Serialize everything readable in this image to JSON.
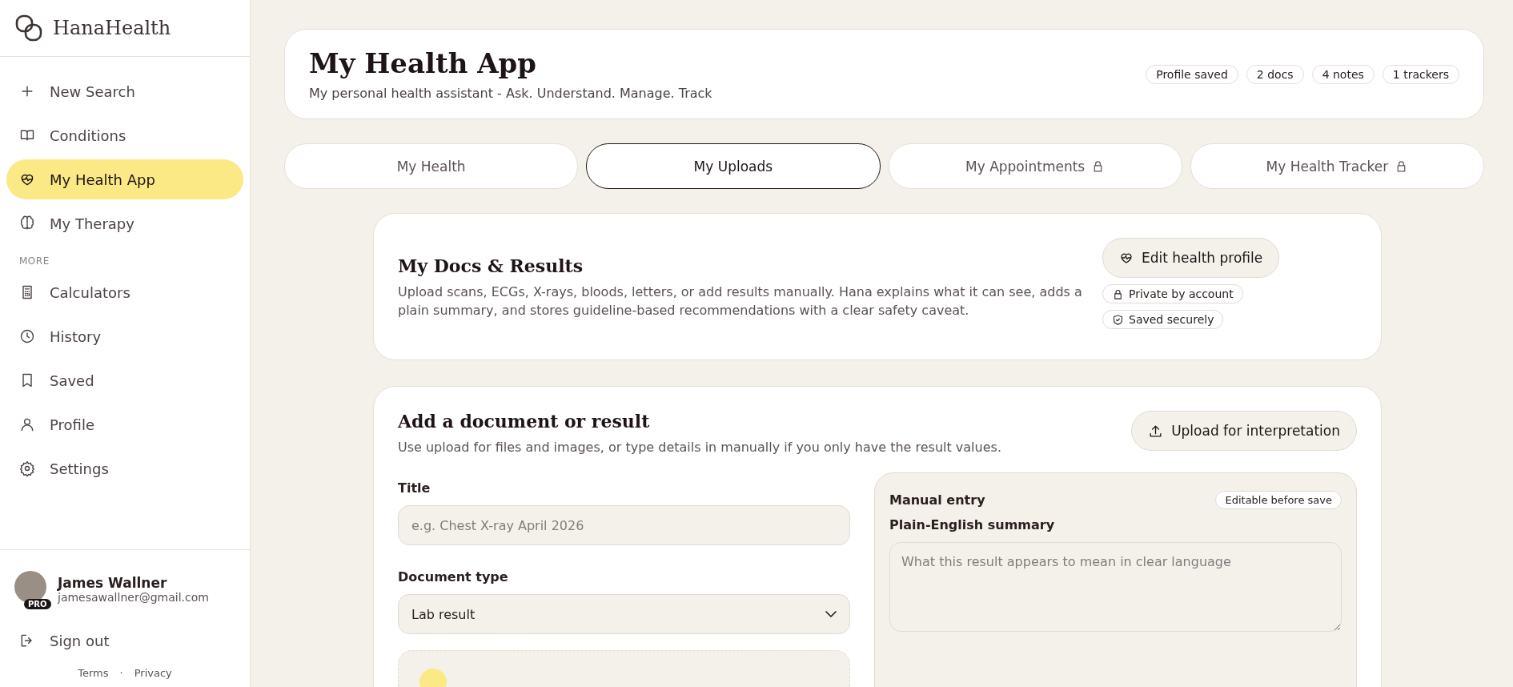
{
  "brand": "HanaHealth",
  "nav": [
    {
      "label": "New Search",
      "kind": "plus",
      "selected": false
    },
    {
      "label": "Conditions",
      "kind": "book",
      "selected": false
    },
    {
      "label": "My Health App",
      "kind": "heart",
      "selected": true
    },
    {
      "label": "My Therapy",
      "kind": "brain",
      "selected": false
    }
  ],
  "more_heading": "MORE",
  "more_nav": [
    {
      "label": "Calculators",
      "kind": "calculator",
      "selected": false
    },
    {
      "label": "History",
      "kind": "clock",
      "selected": false
    },
    {
      "label": "Saved",
      "kind": "bookmark",
      "selected": false
    },
    {
      "label": "Profile",
      "kind": "user",
      "selected": false
    },
    {
      "label": "Settings",
      "kind": "gear",
      "selected": false
    }
  ],
  "user": {
    "name": "James Wallner",
    "email": "jamesawallner@gmail.com",
    "badge": "PRO"
  },
  "sign_out": "Sign out",
  "footer_links": [
    "Terms",
    "Privacy"
  ],
  "footer_separator": "·",
  "header": {
    "title": "My Health App",
    "subtitle": "My personal health assistant - Ask. Understand. Manage. Track",
    "badges": [
      "Profile saved",
      "2 docs",
      "4 notes",
      "1 trackers"
    ]
  },
  "tabs": [
    {
      "label": "My Health",
      "selected": false,
      "locked": false
    },
    {
      "label": "My Uploads",
      "selected": true,
      "locked": false
    },
    {
      "label": "My Appointments",
      "selected": false,
      "locked": true
    },
    {
      "label": "My Health Tracker",
      "selected": false,
      "locked": true
    }
  ],
  "docs": {
    "title": "My Docs & Results",
    "description": "Upload scans, ECGs, X-rays, bloods, letters, or add results manually. Hana explains what it can see, adds a plain summary, and stores guideline-based recommendations with a clear safety caveat.",
    "button": "Edit health profile",
    "chips": [
      {
        "label": "Private by account",
        "kind": "lock"
      },
      {
        "label": "Saved securely",
        "kind": "shield"
      }
    ]
  },
  "add": {
    "title": "Add a document or result",
    "description": "Use upload for files and images, or type details in manually if you only have the result values.",
    "upload_button": "Upload for interpretation",
    "title_label": "Title",
    "title_placeholder": "e.g. Chest X-ray April 2026",
    "type_label": "Document type",
    "type_value": "Lab result",
    "manual": {
      "heading": "Manual entry",
      "chip": "Editable before save",
      "summary_label": "Plain-English summary",
      "summary_placeholder": "What this result appears to mean in clear language"
    }
  }
}
